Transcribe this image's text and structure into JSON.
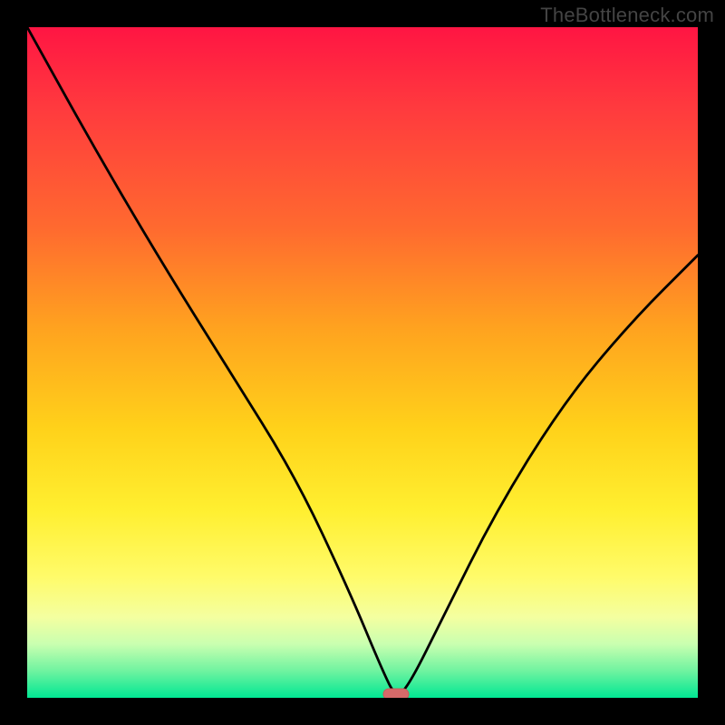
{
  "watermark": "TheBottleneck.com",
  "chart_data": {
    "type": "line",
    "title": "",
    "xlabel": "",
    "ylabel": "",
    "xlim": [
      0,
      100
    ],
    "ylim": [
      0,
      100
    ],
    "grid": false,
    "legend": false,
    "series": [
      {
        "name": "bottleneck-curve",
        "x": [
          0,
          10,
          20,
          30,
          40,
          48,
          53,
          55,
          57,
          62,
          70,
          80,
          90,
          100
        ],
        "values": [
          100,
          82,
          65,
          49,
          33,
          16,
          4,
          0,
          2,
          12,
          28,
          44,
          56,
          66
        ]
      }
    ],
    "minimum_marker": {
      "x": 55,
      "y": 0
    },
    "gradient_stops": [
      {
        "pct": 0,
        "color": "#ff1543"
      },
      {
        "pct": 45,
        "color": "#ffa31f"
      },
      {
        "pct": 72,
        "color": "#ffef30"
      },
      {
        "pct": 96,
        "color": "#6ff3a0"
      },
      {
        "pct": 100,
        "color": "#00e793"
      }
    ]
  }
}
